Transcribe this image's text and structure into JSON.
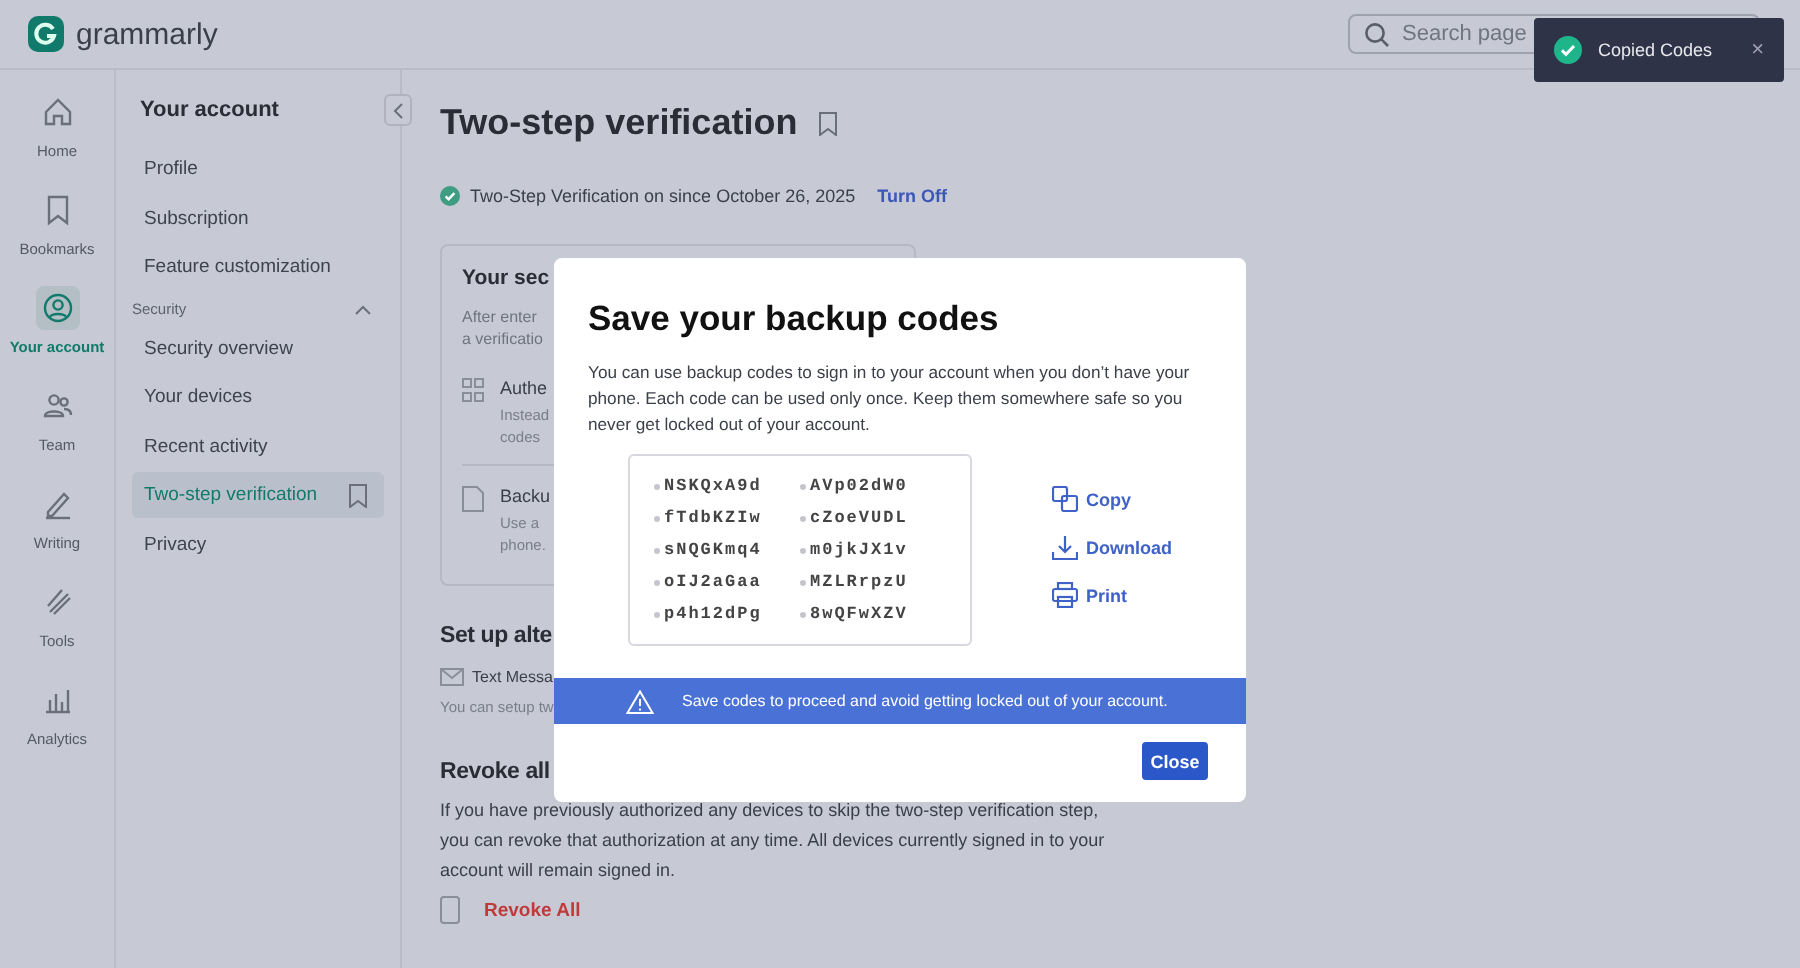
{
  "brand": "grammarly",
  "search": {
    "placeholder": "Search page"
  },
  "toast": {
    "message": "Copied Codes",
    "close": "×"
  },
  "rail": [
    {
      "label": "Home",
      "selected": false
    },
    {
      "label": "Bookmarks",
      "selected": false
    },
    {
      "label": "Your account",
      "selected": true
    },
    {
      "label": "Team",
      "selected": false
    },
    {
      "label": "Writing",
      "selected": false
    },
    {
      "label": "Tools",
      "selected": false
    },
    {
      "label": "Analytics",
      "selected": false
    }
  ],
  "nav": {
    "title": "Your account",
    "items": [
      {
        "label": "Profile",
        "kind": "item",
        "selected": false
      },
      {
        "label": "Subscription",
        "kind": "item",
        "selected": false
      },
      {
        "label": "Feature customization",
        "kind": "item",
        "selected": false
      },
      {
        "label": "Security",
        "kind": "section",
        "expanded": true
      },
      {
        "label": "Security overview",
        "kind": "item",
        "selected": false
      },
      {
        "label": "Your devices",
        "kind": "item",
        "selected": false
      },
      {
        "label": "Recent activity",
        "kind": "item",
        "selected": false
      },
      {
        "label": "Two-step verification",
        "kind": "item",
        "selected": true
      },
      {
        "label": "Privacy",
        "kind": "item",
        "selected": false
      }
    ]
  },
  "page": {
    "title": "Two-step verification",
    "status": "Two-Step Verification on since October 26, 2025",
    "turn_off": "Turn Off",
    "card": {
      "title": "Your sec",
      "intro": [
        "After enter",
        "a verificatio"
      ],
      "methods": [
        {
          "title": "Authe",
          "lines": [
            "Instead",
            "codes"
          ]
        },
        {
          "title": "Backu",
          "lines": [
            "Use a",
            "phone."
          ]
        }
      ]
    },
    "alt": {
      "title": "Set up alte",
      "method": "Text Messa",
      "note": "You can setup tw"
    },
    "revoke": {
      "title": "Revoke all",
      "text": "If you have previously authorized any devices to skip the two-step verification step, you can revoke that authorization at any time. All devices currently signed in to your account will remain signed in.",
      "action": "Revoke All"
    }
  },
  "modal": {
    "title": "Save your backup codes",
    "text": "You can use backup codes to sign in to your account when you don’t have your phone. Each code can be used only once. Keep them somewhere safe so you never get locked out of your account.",
    "codes": [
      "NSKQxA9d",
      "AVp02dW0",
      "fTdbKZIw",
      "cZoeVUDL",
      "sNQGKmq4",
      "m0jkJX1v",
      "oIJ2aGaa",
      "MZLRrpzU",
      "p4h12dPg",
      "8wQFwXZV"
    ],
    "actions": [
      "Copy",
      "Download",
      "Print"
    ],
    "warning": "Save codes to proceed and avoid getting locked out of your account.",
    "close": "Close"
  }
}
